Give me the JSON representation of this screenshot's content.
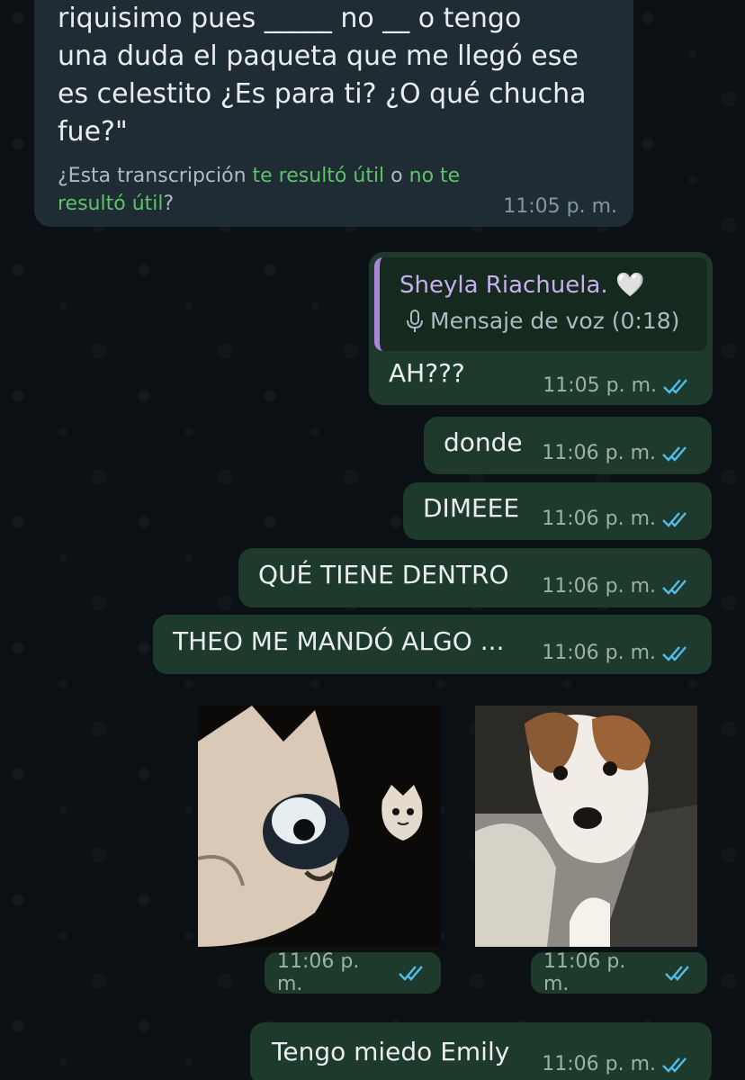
{
  "incoming": {
    "text": "riquisimo pues _____ no __ o tengo\nuna duda el paqueta que me llegó ese\nes celestito ¿Es para ti? ¿O qué chucha\nfue?\"",
    "helpful_prefix": "¿Esta transcripción ",
    "helpful_link1": "te resultó útil",
    "helpful_mid": " o ",
    "helpful_link2": "no te resultó útil",
    "helpful_suffix": "?",
    "time": "11:05 p. m."
  },
  "outgoing": [
    {
      "quote_name": "Sheyla Riachuela. 🤍",
      "quote_body": "Mensaje de voz (0:18)",
      "text": "AH???",
      "time": "11:05 p. m."
    },
    {
      "text": "donde",
      "time": "11:06 p. m."
    },
    {
      "text": "DIMEEE",
      "time": "11:06 p. m."
    },
    {
      "text": "QUÉ TIENE DENTRO",
      "time": "11:06 p. m."
    },
    {
      "text": "THEO ME MANDÓ ALGO ...",
      "time": "11:06 p. m."
    },
    {
      "text": "Tengo miedo Emily",
      "time": "11:06 p. m."
    }
  ],
  "photos": [
    {
      "subject": "cat-sticker",
      "time": "11:06 p. m."
    },
    {
      "subject": "dog-photo",
      "time": "11:06 p. m."
    }
  ],
  "colors": {
    "background": "#0b1014",
    "incoming_bubble": "#1f2c33",
    "outgoing_bubble": "#1d3a2d",
    "read_ticks": "#53bdeb",
    "link_green": "#5ec26b",
    "quote_bar": "#a889d9"
  }
}
